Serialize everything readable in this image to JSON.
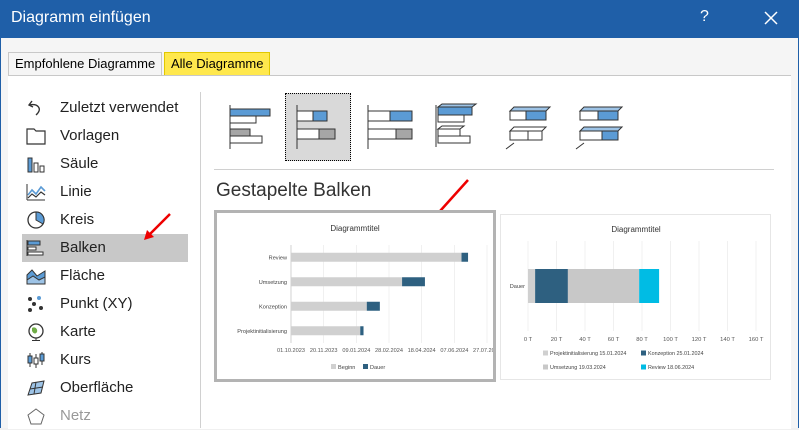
{
  "dialog": {
    "title": "Diagramm einfügen",
    "help": "?"
  },
  "tabs": [
    {
      "label": "Empfohlene Diagramme"
    },
    {
      "label": "Alle Diagramme"
    }
  ],
  "sidebar": {
    "items": [
      {
        "label": "Zuletzt verwendet",
        "icon": "undo-icon"
      },
      {
        "label": "Vorlagen",
        "icon": "folder-icon"
      },
      {
        "label": "Säule",
        "icon": "column-chart-icon"
      },
      {
        "label": "Linie",
        "icon": "line-chart-icon"
      },
      {
        "label": "Kreis",
        "icon": "pie-chart-icon"
      },
      {
        "label": "Balken",
        "icon": "bar-chart-icon"
      },
      {
        "label": "Fläche",
        "icon": "area-chart-icon"
      },
      {
        "label": "Punkt (XY)",
        "icon": "scatter-chart-icon"
      },
      {
        "label": "Karte",
        "icon": "map-chart-icon"
      },
      {
        "label": "Kurs",
        "icon": "stock-chart-icon"
      },
      {
        "label": "Oberfläche",
        "icon": "surface-chart-icon"
      },
      {
        "label": "Netz",
        "icon": "radar-chart-icon"
      }
    ]
  },
  "section_title": "Gestapelte Balken",
  "chart_data": [
    {
      "type": "bar",
      "stacked": true,
      "orientation": "horizontal",
      "title": "Diagrammtitel",
      "categories": [
        "Review",
        "Umsetzung",
        "Konzeption",
        "Projektinitialisierung"
      ],
      "series": [
        {
          "name": "Beginn",
          "values": [
            "18.06.2024",
            "19.03.2024",
            "25.01.2024",
            "15.01.2024"
          ],
          "color": "#d0d0d0"
        },
        {
          "name": "Dauer",
          "values": [
            10,
            35,
            20,
            5
          ],
          "color": "#2e6080"
        }
      ],
      "x_ticks": [
        "01.10.2023",
        "20.11.2023",
        "09.01.2024",
        "28.02.2024",
        "18.04.2024",
        "07.06.2024",
        "27.07.2024"
      ],
      "legend": "bottom"
    },
    {
      "type": "bar",
      "stacked": true,
      "orientation": "horizontal",
      "title": "Diagrammtitel",
      "categories": [
        "Dauer"
      ],
      "series": [
        {
          "name": "Projektinitialisierung 15.01.2024",
          "values": [
            5
          ],
          "color": "#d0d0d0"
        },
        {
          "name": "Konzeption 25.01.2024",
          "values": [
            23
          ],
          "color": "#2e6080"
        },
        {
          "name": "Umsetzung 19.03.2024",
          "values": [
            50
          ],
          "color": "#c8c8c8"
        },
        {
          "name": "Review 18.06.2024",
          "values": [
            14
          ],
          "color": "#00bce4"
        }
      ],
      "x_ticks": [
        "0 T",
        "20 T",
        "40 T",
        "60 T",
        "80 T",
        "100 T",
        "120 T",
        "140 T",
        "160 T"
      ],
      "xlim": [
        0,
        160
      ],
      "legend": "bottom"
    }
  ]
}
